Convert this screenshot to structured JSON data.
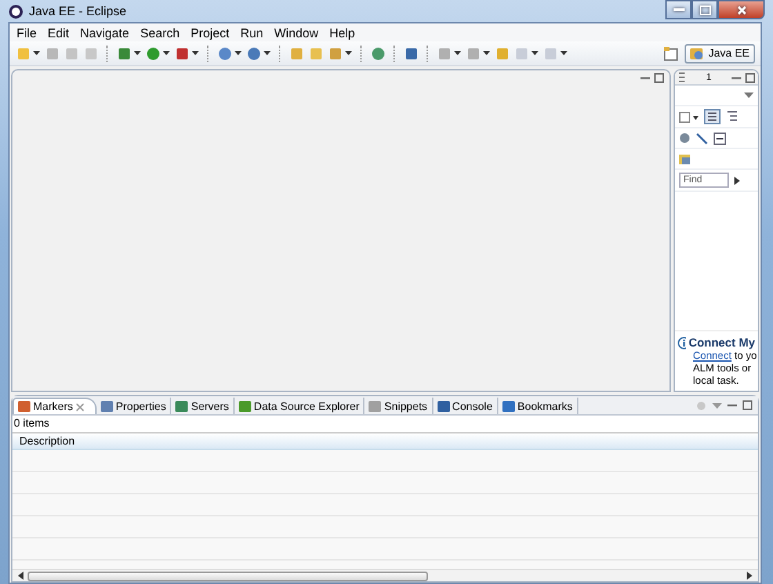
{
  "window": {
    "title": "Java EE - Eclipse"
  },
  "menu": [
    "File",
    "Edit",
    "Navigate",
    "Search",
    "Project",
    "Run",
    "Window",
    "Help"
  ],
  "perspective": {
    "label": "Java EE",
    "selected": true
  },
  "task_panel": {
    "tab_label": "1",
    "find_placeholder": "Find",
    "connect_title": "Connect My",
    "connect_link": "Connect",
    "connect_lines": [
      "to yo",
      "ALM tools or",
      "local task."
    ]
  },
  "bottom_panel": {
    "tabs": [
      {
        "label": "Markers",
        "selected": true
      },
      {
        "label": "Properties",
        "selected": false
      },
      {
        "label": "Servers",
        "selected": false
      },
      {
        "label": "Data Source Explorer",
        "selected": false
      },
      {
        "label": "Snippets",
        "selected": false
      },
      {
        "label": "Console",
        "selected": false
      },
      {
        "label": "Bookmarks",
        "selected": false
      }
    ],
    "count": "0 items",
    "columns": [
      "Description"
    ]
  }
}
